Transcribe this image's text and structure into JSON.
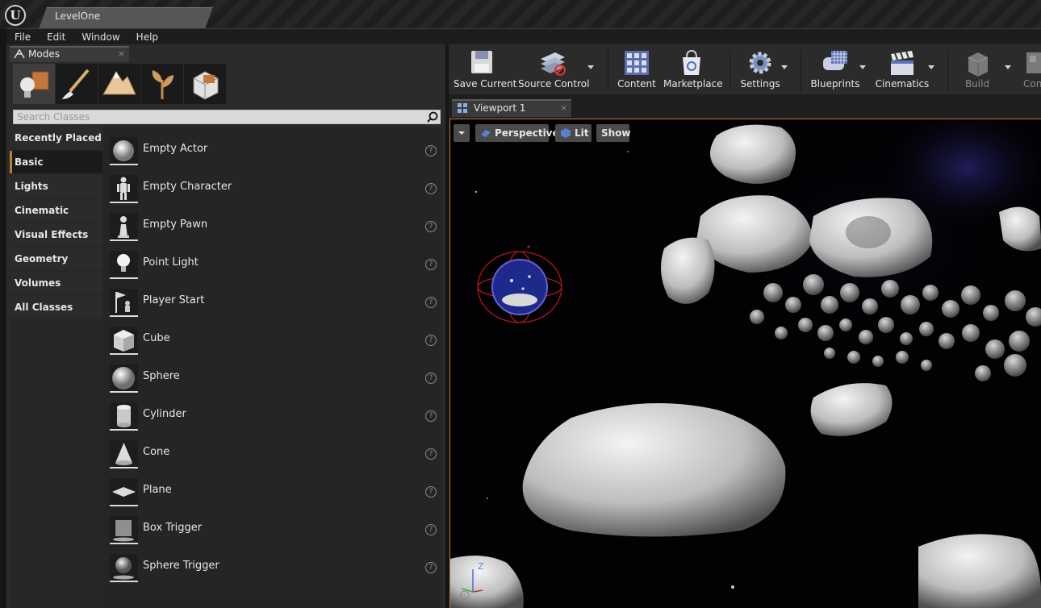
{
  "window": {
    "level_tab": "LevelOne"
  },
  "menu": {
    "items": [
      "File",
      "Edit",
      "Window",
      "Help"
    ]
  },
  "modes_panel": {
    "tab_label": "Modes",
    "close_glyph": "×",
    "mode_icons": [
      "place-mode-icon",
      "paint-mode-icon",
      "landscape-mode-icon",
      "foliage-mode-icon",
      "geometry-edit-mode-icon"
    ],
    "search_placeholder": "Search Classes",
    "categories": [
      {
        "label": "Recently Placed",
        "selected": false
      },
      {
        "label": "Basic",
        "selected": true
      },
      {
        "label": "Lights",
        "selected": false
      },
      {
        "label": "Cinematic",
        "selected": false
      },
      {
        "label": "Visual Effects",
        "selected": false
      },
      {
        "label": "Geometry",
        "selected": false
      },
      {
        "label": "Volumes",
        "selected": false
      },
      {
        "label": "All Classes",
        "selected": false
      }
    ],
    "classes": [
      {
        "label": "Empty Actor",
        "icon": "sphere-actor-icon"
      },
      {
        "label": "Empty Character",
        "icon": "character-icon"
      },
      {
        "label": "Empty Pawn",
        "icon": "pawn-icon"
      },
      {
        "label": "Point Light",
        "icon": "point-light-icon"
      },
      {
        "label": "Player Start",
        "icon": "player-start-icon"
      },
      {
        "label": "Cube",
        "icon": "cube-icon"
      },
      {
        "label": "Sphere",
        "icon": "sphere-icon"
      },
      {
        "label": "Cylinder",
        "icon": "cylinder-icon"
      },
      {
        "label": "Cone",
        "icon": "cone-icon"
      },
      {
        "label": "Plane",
        "icon": "plane-icon"
      },
      {
        "label": "Box Trigger",
        "icon": "box-trigger-icon"
      },
      {
        "label": "Sphere Trigger",
        "icon": "sphere-trigger-icon"
      }
    ],
    "help_glyph": "?"
  },
  "toolbar": {
    "save_current": "Save Current",
    "source_control": "Source Control",
    "content": "Content",
    "marketplace": "Marketplace",
    "settings": "Settings",
    "blueprints": "Blueprints",
    "cinematics": "Cinematics",
    "build": "Build",
    "compile": "Con"
  },
  "viewport": {
    "tab_label": "Viewport 1",
    "close_glyph": "×",
    "perspective": "Perspective",
    "lit": "Lit",
    "show": "Show",
    "gizmo_axis": "Z"
  },
  "colors": {
    "accent": "#b5842a",
    "panel_bg": "#2b2b2b",
    "viewport_bg": "#020204"
  }
}
